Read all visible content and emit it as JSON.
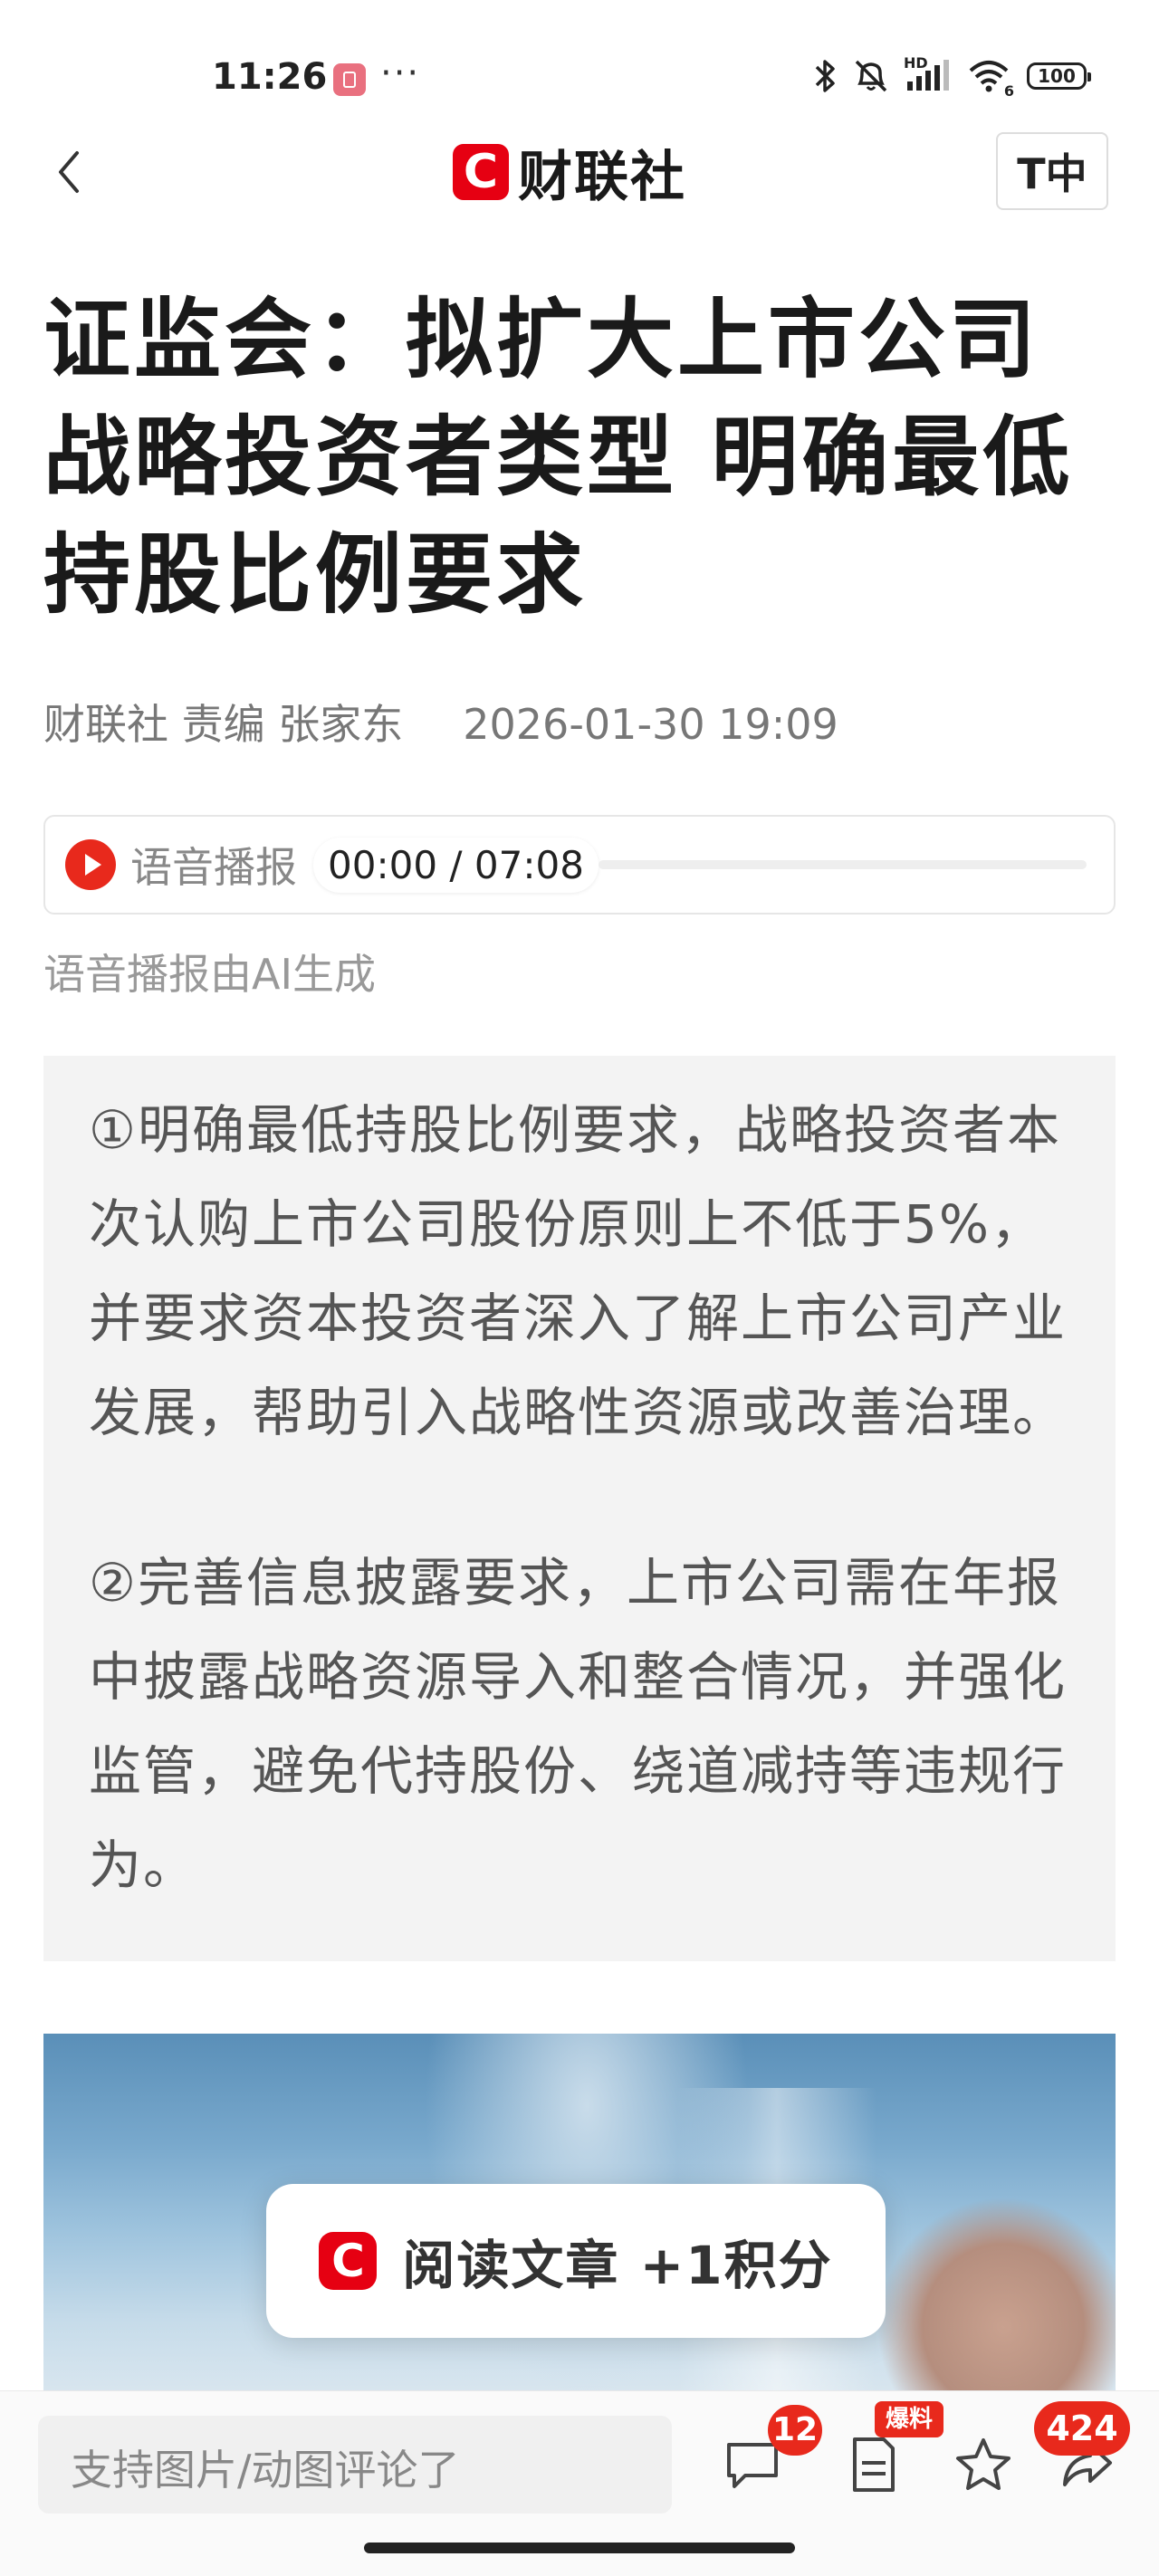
{
  "status_bar": {
    "time": "11:26",
    "more": "···",
    "network": "HD",
    "wifi_sub": "6",
    "battery": "100"
  },
  "nav": {
    "logo_letter": "C",
    "logo_text": "财联社",
    "font_size_label": "T中"
  },
  "article": {
    "title": "证监会：拟扩大上市公司战略投资者类型 明确最低持股比例要求",
    "source": "财联社",
    "editor": "责编 张家东",
    "date": "2026-01-30 19:09"
  },
  "audio": {
    "label": "语音播报",
    "time": "00:00 / 07:08",
    "progress": 0,
    "note": "语音播报由AI生成"
  },
  "summary": {
    "point1": "①明确最低持股比例要求，战略投资者本次认购上市公司股份原则上不低于5%，并要求资本投资者深入了解上市公司产业发展，帮助引入战略性资源或改善治理。",
    "point2": "②完善信息披露要求，上市公司需在年报中披露战略资源导入和整合情况，并强化监管，避免代持股份、绕道减持等违规行为。"
  },
  "toast": {
    "logo_letter": "C",
    "text": "阅读文章 +1积分"
  },
  "bottom_bar": {
    "comment_placeholder": "支持图片/动图评论了",
    "comment_count": "12",
    "report_label": "爆料",
    "share_count": "424"
  },
  "colors": {
    "brand": "#e60012",
    "badge": "#e8291c"
  }
}
